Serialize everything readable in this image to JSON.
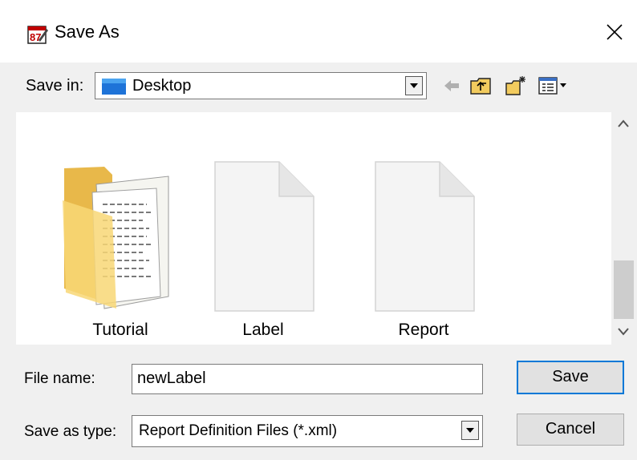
{
  "window": {
    "title": "Save As",
    "icon": "report-designer-icon",
    "close_icon": "close-icon"
  },
  "save_in": {
    "label": "Save in:",
    "value": "Desktop",
    "icon": "desktop-icon"
  },
  "toolbar": {
    "icons": [
      "back-arrow-icon",
      "up-folder-icon",
      "new-folder-icon",
      "view-menu-icon"
    ]
  },
  "files": [
    {
      "name": "Tutorial",
      "icon": "folder-icon"
    },
    {
      "name": "Label",
      "icon": "file-icon"
    },
    {
      "name": "Report",
      "icon": "file-icon"
    }
  ],
  "file_name": {
    "label": "File name:",
    "value": "newLabel"
  },
  "save_as_type": {
    "label": "Save as type:",
    "value": "Report Definition Files (*.xml)"
  },
  "buttons": {
    "save": "Save",
    "cancel": "Cancel"
  },
  "colors": {
    "accent": "#0078d7",
    "dialog_bg": "#f0f0f0",
    "folder": "#f8d775"
  }
}
